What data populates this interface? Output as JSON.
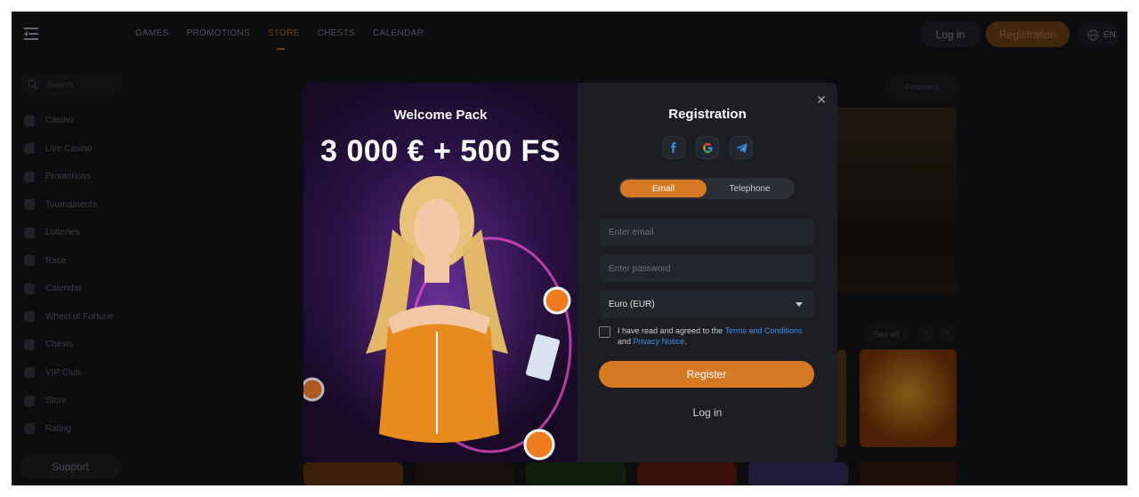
{
  "topbar": {
    "nav": [
      "GAMES",
      "PROMOTIONS",
      "STORE",
      "CHESTS",
      "CALENDAR"
    ],
    "active_nav": "STORE",
    "login_label": "Log in",
    "registration_label": "Registration",
    "language": "EN"
  },
  "sidebar": {
    "search_placeholder": "Search",
    "items": [
      "Casino",
      "Live Casino",
      "Promotions",
      "Tournaments",
      "Lotteries",
      "Race",
      "Calendar",
      "Wheel of Fortune",
      "Chests",
      "VIP Club",
      "Store",
      "Rating"
    ],
    "support_label": "Support"
  },
  "background": {
    "providers_label": "Providers",
    "see_all_label": "See all"
  },
  "promo": {
    "title": "Welcome Pack",
    "amount": "3 000 € + 500 FS"
  },
  "registration": {
    "title": "Registration",
    "socials": [
      "facebook-icon",
      "google-icon",
      "telegram-icon"
    ],
    "tabs": [
      "Email",
      "Telephone"
    ],
    "active_tab": "Email",
    "email_placeholder": "Enter email",
    "password_placeholder": "Enter password",
    "currency": "Euro (EUR)",
    "agree_prefix": "I have read and agreed to the",
    "terms_link": "Terms and Conditions",
    "agree_and": "and",
    "privacy_link": "Privacy Notice",
    "agree_suffix": ".",
    "register_label": "Register",
    "login_label": "Log in"
  },
  "colors": {
    "accent": "#d57a22",
    "link": "#3b8ee8",
    "background": "#17181c",
    "modal": "#1c1e24"
  }
}
